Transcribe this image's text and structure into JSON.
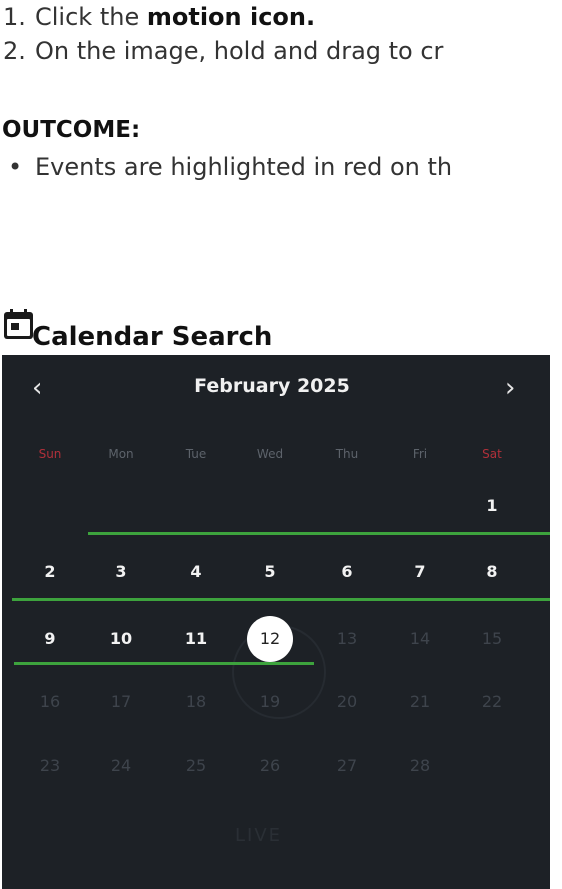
{
  "steps": [
    {
      "number": "1.",
      "before": "Click the ",
      "bold": "motion icon.",
      "after": ""
    },
    {
      "number": "2.",
      "before": "On the image, hold and drag to cr",
      "bold": "",
      "after": ""
    }
  ],
  "outcome": {
    "title": "OUTCOME:",
    "bullet": "•",
    "items": [
      "Events are highlighted in red on th"
    ]
  },
  "calendar_search": {
    "title": "Calendar Search",
    "icon": "calendar-icon",
    "prev_label": "‹",
    "next_label": "›",
    "month_label": "February 2025",
    "weekdays": [
      "Sun",
      "Mon",
      "Tue",
      "Wed",
      "Thu",
      "Fri",
      "Sat"
    ],
    "weeks": [
      [
        "",
        "",
        "",
        "",
        "",
        "",
        "1"
      ],
      [
        "2",
        "3",
        "4",
        "5",
        "6",
        "7",
        "8"
      ],
      [
        "9",
        "10",
        "11",
        "12",
        "13",
        "14",
        "15"
      ],
      [
        "16",
        "17",
        "18",
        "19",
        "20",
        "21",
        "22"
      ],
      [
        "23",
        "24",
        "25",
        "26",
        "27",
        "28",
        ""
      ]
    ],
    "selected_day": "12",
    "days_with_events": [
      "1",
      "2",
      "3",
      "4",
      "5",
      "6",
      "7",
      "8",
      "9",
      "10",
      "11",
      "12"
    ],
    "live_label": "LIVE",
    "colors": {
      "background": "#1d2126",
      "event_line": "#3da33d",
      "weekend_label": "#b0303a",
      "selected_bg": "#ffffff"
    }
  }
}
